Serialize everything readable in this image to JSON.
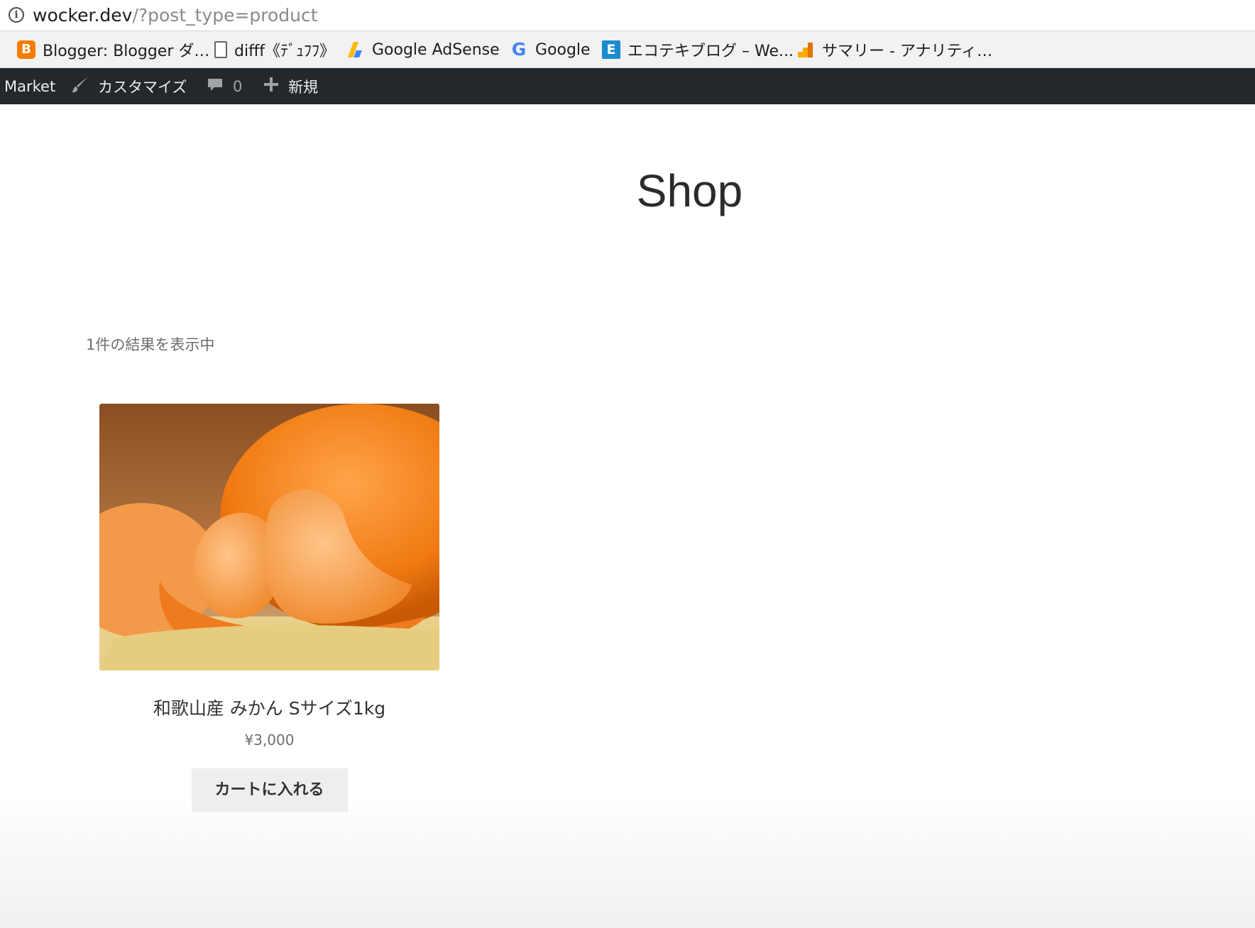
{
  "browser": {
    "url_host": "wocker.dev",
    "url_path": "/?post_type=product"
  },
  "bookmarks": [
    {
      "label": "Blogger: Blogger ダ…",
      "icon": "blogger-icon"
    },
    {
      "label": "difff《ﾃﾞｭﾌﾌ》",
      "icon": "document-icon"
    },
    {
      "label": "Google AdSense",
      "icon": "adsense-icon"
    },
    {
      "label": "Google",
      "icon": "google-icon"
    },
    {
      "label": "エコテキブログ – We...",
      "icon": "e-icon"
    },
    {
      "label": "サマリー - アナリティ…",
      "icon": "analytics-icon"
    }
  ],
  "adminbar": {
    "site": "Market",
    "customize": "カスタマイズ",
    "comments_count": "0",
    "new": "新規"
  },
  "shop": {
    "title": "Shop",
    "result_count": "1件の結果を表示中",
    "product": {
      "title": "和歌山産 みかん Sサイズ1kg",
      "price": "¥3,000",
      "add_to_cart": "カートに入れる"
    }
  },
  "colors": {
    "adminbar_bg": "#23282d",
    "button_bg": "#eeeeee",
    "orange": "#f57d00"
  }
}
